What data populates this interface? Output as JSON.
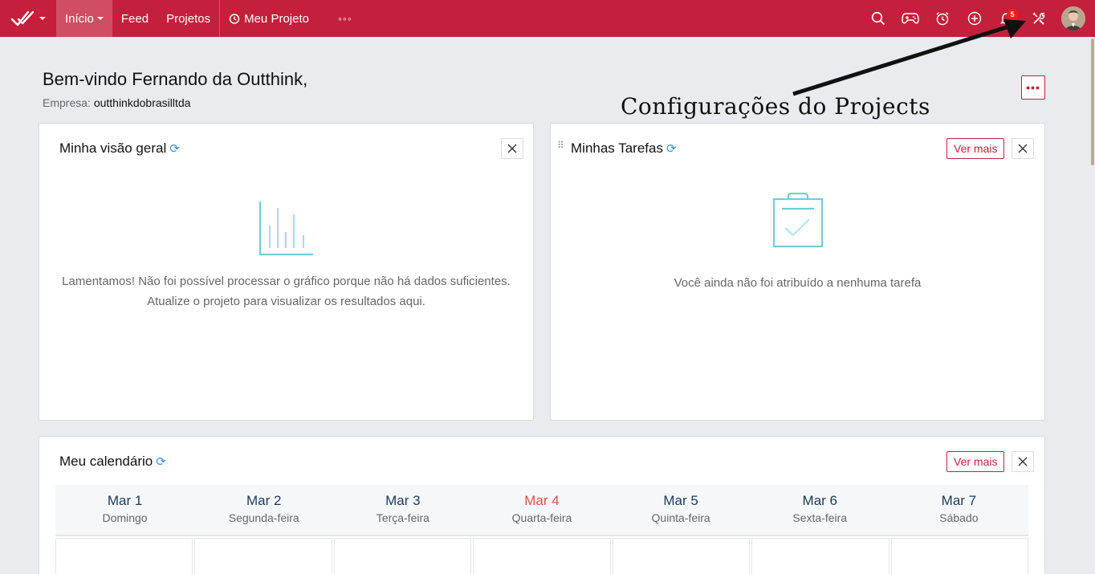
{
  "topbar": {
    "nav": {
      "inicio": "Início",
      "feed": "Feed",
      "projetos": "Projetos",
      "meu_projeto": "Meu Projeto",
      "more": "◦◦◦"
    },
    "notification_count": "5",
    "icons": [
      "logo-checkmark-icon",
      "search-icon",
      "gamepad-icon",
      "alarm-clock-icon",
      "add-circle-icon",
      "bell-icon",
      "tools-icon",
      "avatar"
    ]
  },
  "welcome": {
    "title": "Bem-vindo Fernando da Outthink,",
    "company_label": "Empresa:",
    "company_value": "outthinkdobrasilltda"
  },
  "annotation": {
    "text": "Configurações do Projects"
  },
  "overview_card": {
    "title": "Minha visão geral",
    "message_line1": "Lamentamos! Não foi possível processar o gráfico porque não há dados suficientes.",
    "message_line2": "Atualize o projeto para visualizar os resultados aqui."
  },
  "tasks_card": {
    "title": "Minhas Tarefas",
    "more_label": "Ver mais",
    "message": "Você ainda não foi atribuído a nenhuma tarefa"
  },
  "calendar_card": {
    "title": "Meu calendário",
    "more_label": "Ver mais",
    "days": [
      {
        "date": "Mar 1",
        "weekday": "Domingo",
        "today": false
      },
      {
        "date": "Mar 2",
        "weekday": "Segunda-feira",
        "today": false
      },
      {
        "date": "Mar 3",
        "weekday": "Terça-feira",
        "today": false
      },
      {
        "date": "Mar 4",
        "weekday": "Quarta-feira",
        "today": true
      },
      {
        "date": "Mar 5",
        "weekday": "Quinta-feira",
        "today": false
      },
      {
        "date": "Mar 6",
        "weekday": "Sexta-feira",
        "today": false
      },
      {
        "date": "Mar 7",
        "weekday": "Sábado",
        "today": false
      }
    ]
  },
  "colors": {
    "brand": "#c41f3b",
    "accent_teal": "#6fcfd2",
    "today": "#e25050"
  }
}
